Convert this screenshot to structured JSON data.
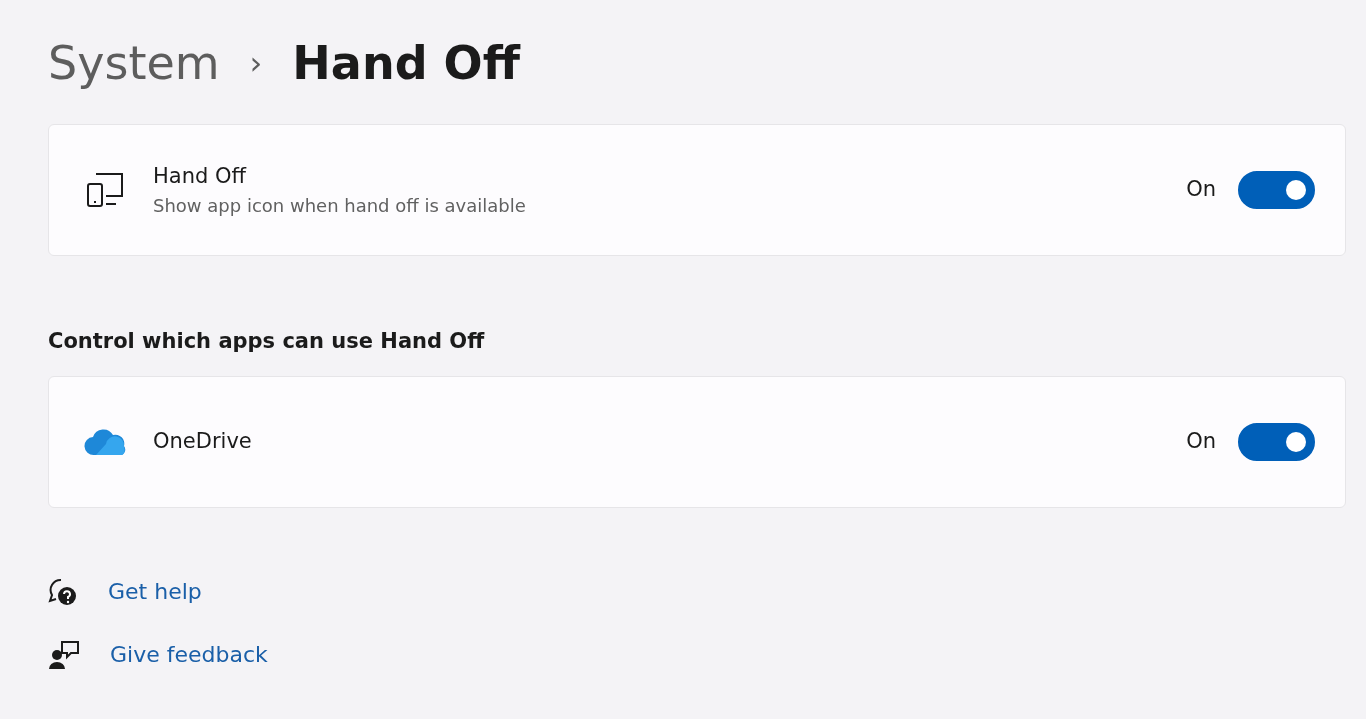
{
  "breadcrumb": {
    "parent": "System",
    "separator": "›",
    "current": "Hand Off"
  },
  "settings": [
    {
      "title": "Hand Off",
      "description": "Show app icon when hand off is available",
      "state_label": "On",
      "on": true
    }
  ],
  "section_heading": "Control which apps can use Hand Off",
  "apps": [
    {
      "name": "OneDrive",
      "state_label": "On",
      "on": true
    }
  ],
  "links": [
    {
      "label": "Get help",
      "kind": "help"
    },
    {
      "label": "Give feedback",
      "kind": "feedback"
    }
  ]
}
